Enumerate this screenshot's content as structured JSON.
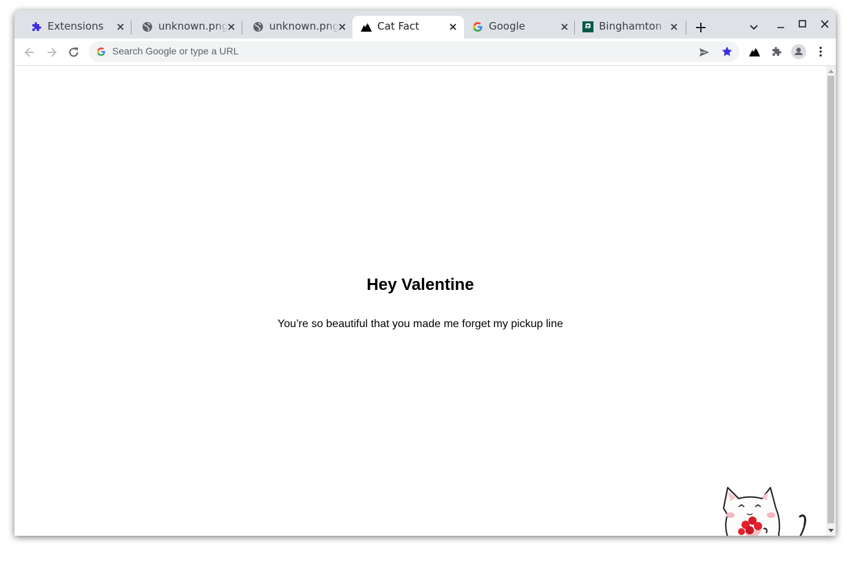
{
  "tabs": [
    {
      "title": "Extensions",
      "icon": "puzzle-icon"
    },
    {
      "title": "unknown.png",
      "icon": "globe-icon"
    },
    {
      "title": "unknown.png",
      "icon": "globe-icon"
    },
    {
      "title": "Cat Fact",
      "icon": "mountain-icon",
      "active": true
    },
    {
      "title": "Google",
      "icon": "google-g-icon"
    },
    {
      "title": "Binghamton U",
      "icon": "binghamton-logo-icon"
    }
  ],
  "omnibox": {
    "placeholder": "Search Google or type a URL"
  },
  "page": {
    "heading": "Hey Valentine",
    "line": "You’re so beautiful that you made me forget my pickup line"
  },
  "colors": {
    "accent": "#3c2ee0",
    "tabbar": "#dee1e6"
  }
}
